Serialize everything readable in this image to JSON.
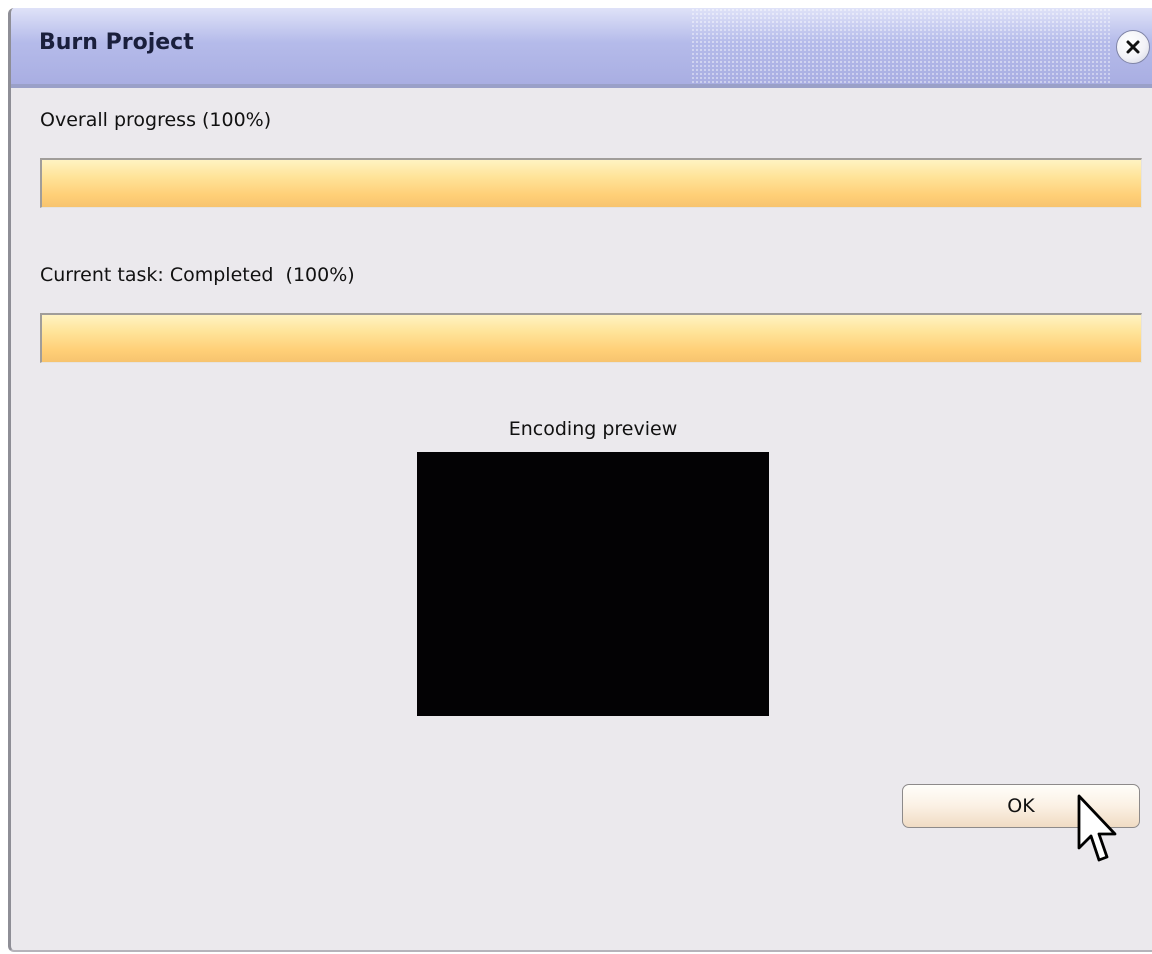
{
  "window": {
    "title": "Burn Project",
    "close_icon": "close-icon"
  },
  "overall": {
    "label": "Overall progress (100%)",
    "progress_percent": 100
  },
  "current_task": {
    "label": "Current task: Completed  (100%)",
    "progress_percent": 100
  },
  "preview": {
    "label": "Encoding preview"
  },
  "buttons": {
    "ok_label": "OK"
  },
  "colors": {
    "progress_fill": "#ffd889",
    "titlebar": "#b5bbea",
    "dialog_background": "#ebe9ed",
    "preview_background": "#030204"
  },
  "cursor_icon": "mouse-pointer-icon"
}
